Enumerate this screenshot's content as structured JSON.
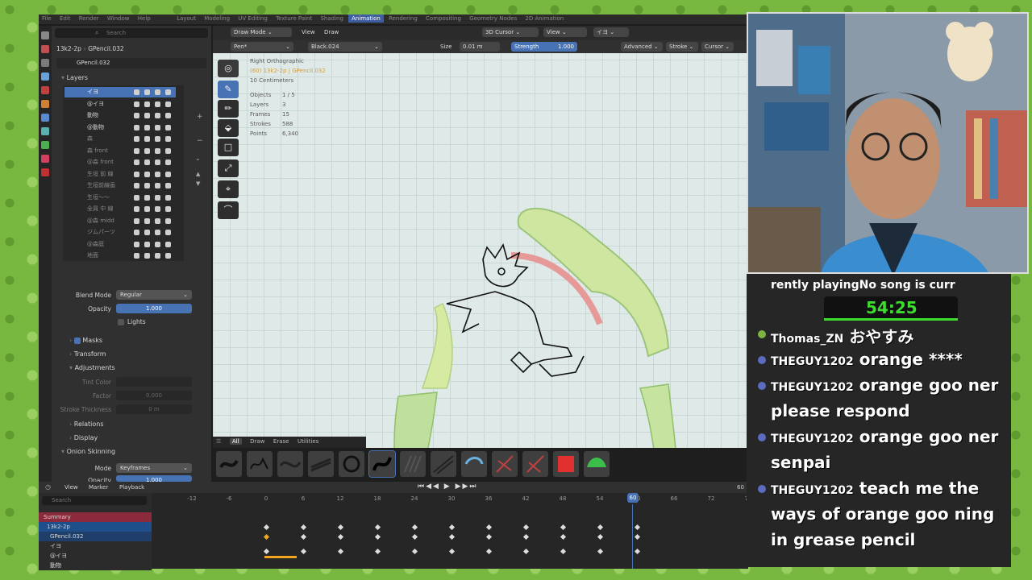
{
  "topbar": {
    "menus": [
      "File",
      "Edit",
      "Render",
      "Window",
      "Help"
    ],
    "workspaces": [
      "Layout",
      "Modeling",
      "UV Editing",
      "Texture Paint",
      "Shading",
      "Animation",
      "Rendering",
      "Compositing",
      "Geometry Nodes",
      "2D Animation"
    ]
  },
  "properties": {
    "search_placeholder": "Search",
    "breadcrumb_scene": "13k2-2p",
    "breadcrumb_object": "GPencil.032",
    "data_name": "GPencil.032",
    "layers_title": "Layers",
    "layers": [
      {
        "name": "イヨ",
        "selected": true
      },
      {
        "name": "@イヨ"
      },
      {
        "name": "動物"
      },
      {
        "name": "@動物"
      },
      {
        "name": "森"
      },
      {
        "name": "森 front"
      },
      {
        "name": "@森 front"
      },
      {
        "name": "生垣 前 線"
      },
      {
        "name": "生垣前線画"
      },
      {
        "name": "生垣〜〜"
      },
      {
        "name": "全員 中 線"
      },
      {
        "name": "@森 midd"
      },
      {
        "name": "ジムパーツ"
      },
      {
        "name": "@森庭"
      },
      {
        "name": "地面"
      }
    ],
    "blend_mode_label": "Blend Mode",
    "blend_mode_value": "Regular",
    "opacity_label": "Opacity",
    "opacity_value": "1.000",
    "lights_label": "Lights",
    "masks_label": "Masks",
    "transform_label": "Transform",
    "adjustments_label": "Adjustments",
    "tint_color_label": "Tint Color",
    "factor_label": "Factor",
    "factor_value": "0.000",
    "stroke_thickness_label": "Stroke Thickness",
    "stroke_thickness_value": "0 m",
    "relations_label": "Relations",
    "display_label": "Display",
    "onion_label": "Onion Skinning",
    "mode_label": "Mode",
    "mode_value": "Keyframes",
    "opacity2_label": "Opacity",
    "opacity2_value": "1.000"
  },
  "viewport": {
    "mode": "Draw Mode",
    "menu_view": "View",
    "menu_draw": "Draw",
    "cursor_label": "3D Cursor",
    "view_label": "View",
    "layer_label": "イヨ",
    "brush": "Pen*",
    "material": "Black.024",
    "size_label": "Size",
    "size_value": "0.01 m",
    "strength_label": "Strength",
    "strength_value": "1.000",
    "advanced": "Advanced",
    "stroke": "Stroke",
    "cursor": "Cursor",
    "info_view": "Right Orthographic",
    "info_object": "(60) 13k2-2p | GPencil.032",
    "info_scale": "10 Centimeters",
    "stats": [
      {
        "k": "Objects",
        "v": "1 / 5"
      },
      {
        "k": "Layers",
        "v": "3"
      },
      {
        "k": "Frames",
        "v": "15"
      },
      {
        "k": "Strokes",
        "v": "588"
      },
      {
        "k": "Points",
        "v": "6,340"
      }
    ]
  },
  "brush_tabs": [
    "All",
    "Draw",
    "Erase",
    "Utilities"
  ],
  "timeline": {
    "menus": [
      "View",
      "Marker",
      "Playback"
    ],
    "current_frame": "60",
    "search_placeholder": "Search",
    "ticks": [
      "-12",
      "-6",
      "0",
      "6",
      "12",
      "18",
      "24",
      "30",
      "36",
      "42",
      "48",
      "54",
      "60",
      "66",
      "72",
      "78"
    ],
    "rows": [
      "Summary",
      "13k2-2p",
      "GPencil.032",
      "イヨ",
      "@イヨ",
      "動物"
    ]
  },
  "overlay": {
    "now_playing": "rently playingNo song is curr",
    "timer": "54:25",
    "accent": "#3ddc2f"
  },
  "chat": [
    {
      "user": "Thomas_ZN",
      "text": "おやすみ"
    },
    {
      "user": "THEGUY1202",
      "text": "orange ****"
    },
    {
      "user": "THEGUY1202",
      "text": "orange goo ner"
    },
    {
      "user": "",
      "text": "please respond"
    },
    {
      "user": "THEGUY1202",
      "text": "orange goo ner"
    },
    {
      "user": "",
      "text": "senpai"
    },
    {
      "user": "THEGUY1202",
      "text": "teach me the"
    },
    {
      "user": "",
      "text": "ways of orange goo ning"
    },
    {
      "user": "",
      "text": "in grease pencil"
    }
  ]
}
